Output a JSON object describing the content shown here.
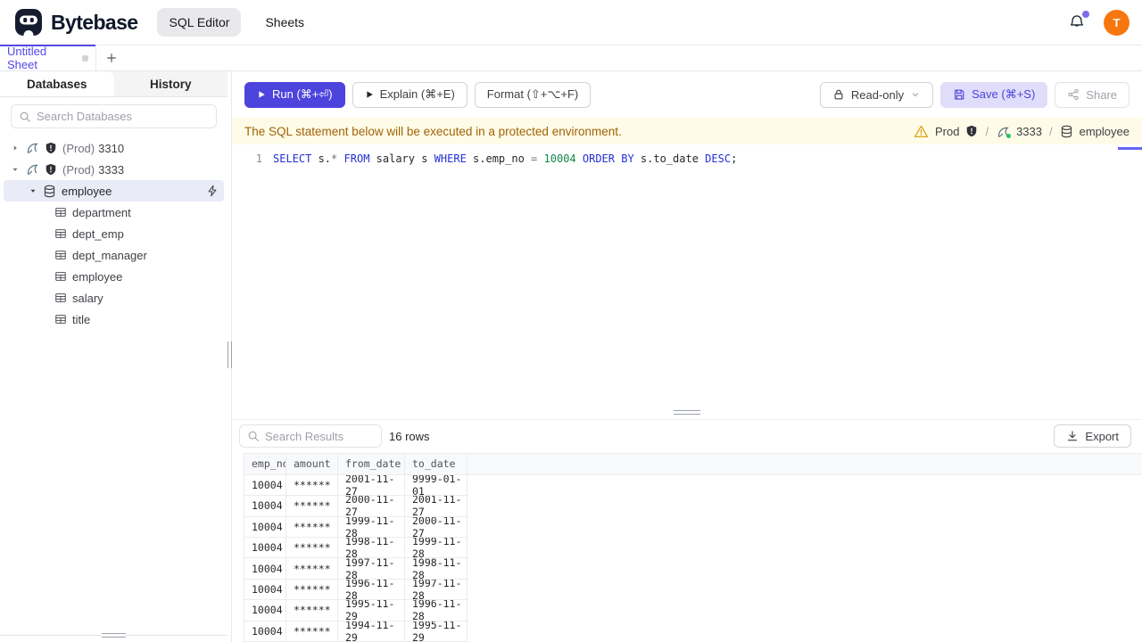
{
  "header": {
    "logo_text": "Bytebase",
    "nav_sql_editor": "SQL Editor",
    "nav_sheets": "Sheets",
    "avatar_text": "T"
  },
  "tabbar": {
    "active_tab": "Untitled Sheet"
  },
  "sidebar": {
    "tab_databases": "Databases",
    "tab_history": "History",
    "search_placeholder": "Search Databases",
    "tree": [
      {
        "kind": "instance",
        "env": "(Prod)",
        "name": "3310",
        "expanded": false
      },
      {
        "kind": "instance",
        "env": "(Prod)",
        "name": "3333",
        "expanded": true
      },
      {
        "kind": "database",
        "name": "employee",
        "selected": true
      },
      {
        "kind": "table",
        "name": "department"
      },
      {
        "kind": "table",
        "name": "dept_emp"
      },
      {
        "kind": "table",
        "name": "dept_manager"
      },
      {
        "kind": "table",
        "name": "employee"
      },
      {
        "kind": "table",
        "name": "salary"
      },
      {
        "kind": "table",
        "name": "title"
      }
    ]
  },
  "toolbar": {
    "run_label": "Run (⌘+⏎)",
    "explain_label": "Explain (⌘+E)",
    "format_label": "Format (⇧+⌥+F)",
    "readonly_label": "Read-only",
    "save_label": "Save (⌘+S)",
    "share_label": "Share"
  },
  "notice": {
    "message": "The SQL statement below will be executed in a protected environment.",
    "environment": "Prod",
    "instance": "3333",
    "database": "employee",
    "separator": "/"
  },
  "editor": {
    "line_number": "1",
    "sql": "SELECT s.* FROM salary s WHERE s.emp_no = 10004 ORDER BY s.to_date DESC;",
    "tokens": [
      {
        "text": "SELECT",
        "type": "keyword"
      },
      {
        "text": " s.",
        "type": "plain"
      },
      {
        "text": "*",
        "type": "operator"
      },
      {
        "text": " ",
        "type": "plain"
      },
      {
        "text": "FROM",
        "type": "keyword"
      },
      {
        "text": " salary s ",
        "type": "plain"
      },
      {
        "text": "WHERE",
        "type": "keyword"
      },
      {
        "text": " s.emp_no ",
        "type": "plain"
      },
      {
        "text": "=",
        "type": "operator"
      },
      {
        "text": " ",
        "type": "plain"
      },
      {
        "text": "10004",
        "type": "number"
      },
      {
        "text": " ",
        "type": "plain"
      },
      {
        "text": "ORDER BY",
        "type": "keyword"
      },
      {
        "text": " s.to_date ",
        "type": "plain"
      },
      {
        "text": "DESC",
        "type": "keyword"
      },
      {
        "text": ";",
        "type": "plain"
      }
    ]
  },
  "results": {
    "search_placeholder": "Search Results",
    "row_count": "16 rows",
    "export_label": "Export",
    "columns": [
      "emp_no",
      "amount",
      "from_date",
      "to_date"
    ],
    "rows": [
      [
        "10004",
        "******",
        "2001-11-27",
        "9999-01-01"
      ],
      [
        "10004",
        "******",
        "2000-11-27",
        "2001-11-27"
      ],
      [
        "10004",
        "******",
        "1999-11-28",
        "2000-11-27"
      ],
      [
        "10004",
        "******",
        "1998-11-28",
        "1999-11-28"
      ],
      [
        "10004",
        "******",
        "1997-11-28",
        "1998-11-28"
      ],
      [
        "10004",
        "******",
        "1996-11-28",
        "1997-11-28"
      ],
      [
        "10004",
        "******",
        "1995-11-29",
        "1996-11-28"
      ],
      [
        "10004",
        "******",
        "1994-11-29",
        "1995-11-29"
      ]
    ]
  },
  "colors": {
    "accent": "#4d43dd",
    "warning_bg": "#fefce8",
    "warning_text": "#a16207",
    "avatar_bg": "#f97316",
    "notification_dot": "#7b6cf0",
    "sql_keyword": "#2430d6",
    "sql_number": "#13854b",
    "mysql_status_dot": "#22c55e"
  }
}
